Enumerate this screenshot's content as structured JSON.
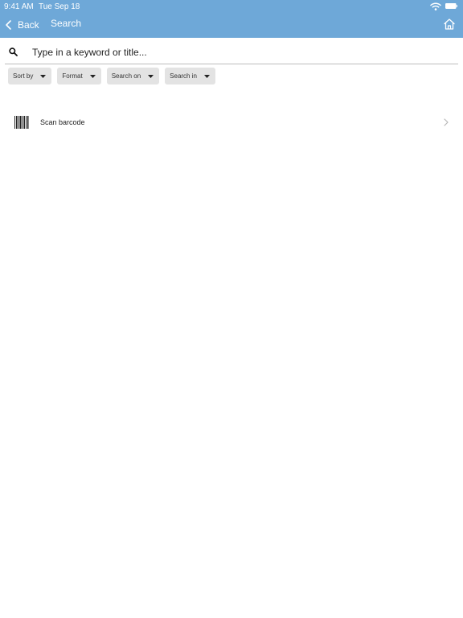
{
  "status_bar": {
    "time": "9:41 AM",
    "date": "Tue Sep 18",
    "wifi_icon": "wifi-icon",
    "battery_icon": "battery-icon"
  },
  "nav": {
    "back_label": "Back",
    "title": "Search",
    "home_icon": "home-icon"
  },
  "search": {
    "placeholder": "Type in a keyword or title...",
    "value": "",
    "icon": "search-icon"
  },
  "filters": [
    {
      "label": "Sort by"
    },
    {
      "label": "Format"
    },
    {
      "label": "Search on"
    },
    {
      "label": "Search in"
    }
  ],
  "scan": {
    "label": "Scan barcode",
    "icon": "barcode-icon"
  },
  "colors": {
    "header": "#6ea8d8",
    "chip_bg": "#e3e3e3",
    "background": "#ffffff"
  }
}
